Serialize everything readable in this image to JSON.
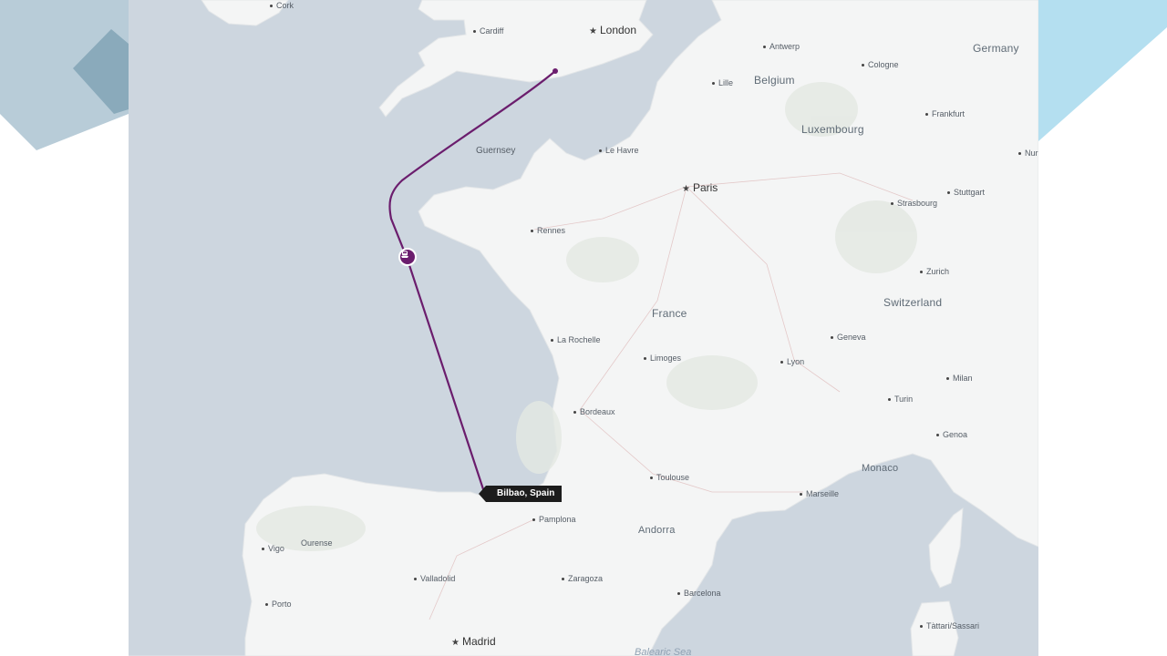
{
  "map": {
    "route_color": "#6b1d6d",
    "land_color": "#f4f5f5",
    "sea_color": "#cdd6df",
    "tooltip": "Bilbao, Spain",
    "vehicle_icon": "ferry-icon",
    "labels": {
      "cork": "Cork",
      "cardiff": "Cardiff",
      "london": "London",
      "antwerp": "Antwerp",
      "cologne": "Cologne",
      "germany": "Germany",
      "lille": "Lille",
      "belgium": "Belgium",
      "luxembourg": "Luxembourg",
      "frankfurt": "Frankfurt",
      "nurnberg": "Nur",
      "guernsey": "Guernsey",
      "lehavre": "Le Havre",
      "paris": "Paris",
      "strasbourg": "Strasbourg",
      "stuttgart": "Stuttgart",
      "rennes": "Rennes",
      "zurich": "Zurich",
      "switzerland": "Switzerland",
      "france": "France",
      "larochelle": "La Rochelle",
      "geneva": "Geneva",
      "limoges": "Limoges",
      "lyon": "Lyon",
      "milan": "Milan",
      "bordeaux": "Bordeaux",
      "turin": "Turin",
      "genoa": "Genoa",
      "toulouse": "Toulouse",
      "monaco": "Monaco",
      "marseille": "Marseille",
      "pamplona": "Pamplona",
      "andorra": "Andorra",
      "vigo": "Vigo",
      "ourense": "Ourense",
      "valladolid": "Valladolid",
      "zaragoza": "Zaragoza",
      "barcelona": "Barcelona",
      "porto": "Porto",
      "madrid": "Madrid",
      "sassari": "Tàttari/Sassari",
      "balearic": "Balearic Sea"
    }
  }
}
